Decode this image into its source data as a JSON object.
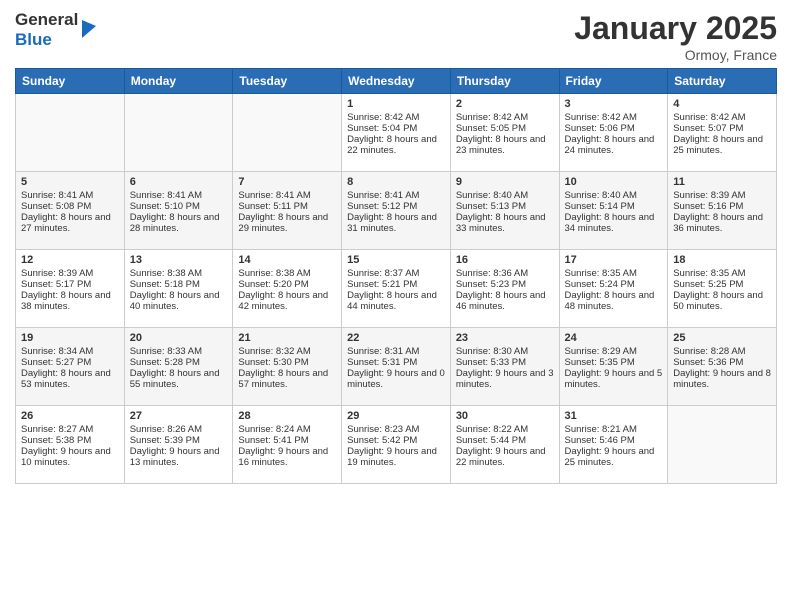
{
  "logo": {
    "general": "General",
    "blue": "Blue"
  },
  "title": "January 2025",
  "location": "Ormoy, France",
  "days_of_week": [
    "Sunday",
    "Monday",
    "Tuesday",
    "Wednesday",
    "Thursday",
    "Friday",
    "Saturday"
  ],
  "weeks": [
    [
      {
        "day": "",
        "sunrise": "",
        "sunset": "",
        "daylight": ""
      },
      {
        "day": "",
        "sunrise": "",
        "sunset": "",
        "daylight": ""
      },
      {
        "day": "",
        "sunrise": "",
        "sunset": "",
        "daylight": ""
      },
      {
        "day": "1",
        "sunrise": "Sunrise: 8:42 AM",
        "sunset": "Sunset: 5:04 PM",
        "daylight": "Daylight: 8 hours and 22 minutes."
      },
      {
        "day": "2",
        "sunrise": "Sunrise: 8:42 AM",
        "sunset": "Sunset: 5:05 PM",
        "daylight": "Daylight: 8 hours and 23 minutes."
      },
      {
        "day": "3",
        "sunrise": "Sunrise: 8:42 AM",
        "sunset": "Sunset: 5:06 PM",
        "daylight": "Daylight: 8 hours and 24 minutes."
      },
      {
        "day": "4",
        "sunrise": "Sunrise: 8:42 AM",
        "sunset": "Sunset: 5:07 PM",
        "daylight": "Daylight: 8 hours and 25 minutes."
      }
    ],
    [
      {
        "day": "5",
        "sunrise": "Sunrise: 8:41 AM",
        "sunset": "Sunset: 5:08 PM",
        "daylight": "Daylight: 8 hours and 27 minutes."
      },
      {
        "day": "6",
        "sunrise": "Sunrise: 8:41 AM",
        "sunset": "Sunset: 5:10 PM",
        "daylight": "Daylight: 8 hours and 28 minutes."
      },
      {
        "day": "7",
        "sunrise": "Sunrise: 8:41 AM",
        "sunset": "Sunset: 5:11 PM",
        "daylight": "Daylight: 8 hours and 29 minutes."
      },
      {
        "day": "8",
        "sunrise": "Sunrise: 8:41 AM",
        "sunset": "Sunset: 5:12 PM",
        "daylight": "Daylight: 8 hours and 31 minutes."
      },
      {
        "day": "9",
        "sunrise": "Sunrise: 8:40 AM",
        "sunset": "Sunset: 5:13 PM",
        "daylight": "Daylight: 8 hours and 33 minutes."
      },
      {
        "day": "10",
        "sunrise": "Sunrise: 8:40 AM",
        "sunset": "Sunset: 5:14 PM",
        "daylight": "Daylight: 8 hours and 34 minutes."
      },
      {
        "day": "11",
        "sunrise": "Sunrise: 8:39 AM",
        "sunset": "Sunset: 5:16 PM",
        "daylight": "Daylight: 8 hours and 36 minutes."
      }
    ],
    [
      {
        "day": "12",
        "sunrise": "Sunrise: 8:39 AM",
        "sunset": "Sunset: 5:17 PM",
        "daylight": "Daylight: 8 hours and 38 minutes."
      },
      {
        "day": "13",
        "sunrise": "Sunrise: 8:38 AM",
        "sunset": "Sunset: 5:18 PM",
        "daylight": "Daylight: 8 hours and 40 minutes."
      },
      {
        "day": "14",
        "sunrise": "Sunrise: 8:38 AM",
        "sunset": "Sunset: 5:20 PM",
        "daylight": "Daylight: 8 hours and 42 minutes."
      },
      {
        "day": "15",
        "sunrise": "Sunrise: 8:37 AM",
        "sunset": "Sunset: 5:21 PM",
        "daylight": "Daylight: 8 hours and 44 minutes."
      },
      {
        "day": "16",
        "sunrise": "Sunrise: 8:36 AM",
        "sunset": "Sunset: 5:23 PM",
        "daylight": "Daylight: 8 hours and 46 minutes."
      },
      {
        "day": "17",
        "sunrise": "Sunrise: 8:35 AM",
        "sunset": "Sunset: 5:24 PM",
        "daylight": "Daylight: 8 hours and 48 minutes."
      },
      {
        "day": "18",
        "sunrise": "Sunrise: 8:35 AM",
        "sunset": "Sunset: 5:25 PM",
        "daylight": "Daylight: 8 hours and 50 minutes."
      }
    ],
    [
      {
        "day": "19",
        "sunrise": "Sunrise: 8:34 AM",
        "sunset": "Sunset: 5:27 PM",
        "daylight": "Daylight: 8 hours and 53 minutes."
      },
      {
        "day": "20",
        "sunrise": "Sunrise: 8:33 AM",
        "sunset": "Sunset: 5:28 PM",
        "daylight": "Daylight: 8 hours and 55 minutes."
      },
      {
        "day": "21",
        "sunrise": "Sunrise: 8:32 AM",
        "sunset": "Sunset: 5:30 PM",
        "daylight": "Daylight: 8 hours and 57 minutes."
      },
      {
        "day": "22",
        "sunrise": "Sunrise: 8:31 AM",
        "sunset": "Sunset: 5:31 PM",
        "daylight": "Daylight: 9 hours and 0 minutes."
      },
      {
        "day": "23",
        "sunrise": "Sunrise: 8:30 AM",
        "sunset": "Sunset: 5:33 PM",
        "daylight": "Daylight: 9 hours and 3 minutes."
      },
      {
        "day": "24",
        "sunrise": "Sunrise: 8:29 AM",
        "sunset": "Sunset: 5:35 PM",
        "daylight": "Daylight: 9 hours and 5 minutes."
      },
      {
        "day": "25",
        "sunrise": "Sunrise: 8:28 AM",
        "sunset": "Sunset: 5:36 PM",
        "daylight": "Daylight: 9 hours and 8 minutes."
      }
    ],
    [
      {
        "day": "26",
        "sunrise": "Sunrise: 8:27 AM",
        "sunset": "Sunset: 5:38 PM",
        "daylight": "Daylight: 9 hours and 10 minutes."
      },
      {
        "day": "27",
        "sunrise": "Sunrise: 8:26 AM",
        "sunset": "Sunset: 5:39 PM",
        "daylight": "Daylight: 9 hours and 13 minutes."
      },
      {
        "day": "28",
        "sunrise": "Sunrise: 8:24 AM",
        "sunset": "Sunset: 5:41 PM",
        "daylight": "Daylight: 9 hours and 16 minutes."
      },
      {
        "day": "29",
        "sunrise": "Sunrise: 8:23 AM",
        "sunset": "Sunset: 5:42 PM",
        "daylight": "Daylight: 9 hours and 19 minutes."
      },
      {
        "day": "30",
        "sunrise": "Sunrise: 8:22 AM",
        "sunset": "Sunset: 5:44 PM",
        "daylight": "Daylight: 9 hours and 22 minutes."
      },
      {
        "day": "31",
        "sunrise": "Sunrise: 8:21 AM",
        "sunset": "Sunset: 5:46 PM",
        "daylight": "Daylight: 9 hours and 25 minutes."
      },
      {
        "day": "",
        "sunrise": "",
        "sunset": "",
        "daylight": ""
      }
    ]
  ]
}
